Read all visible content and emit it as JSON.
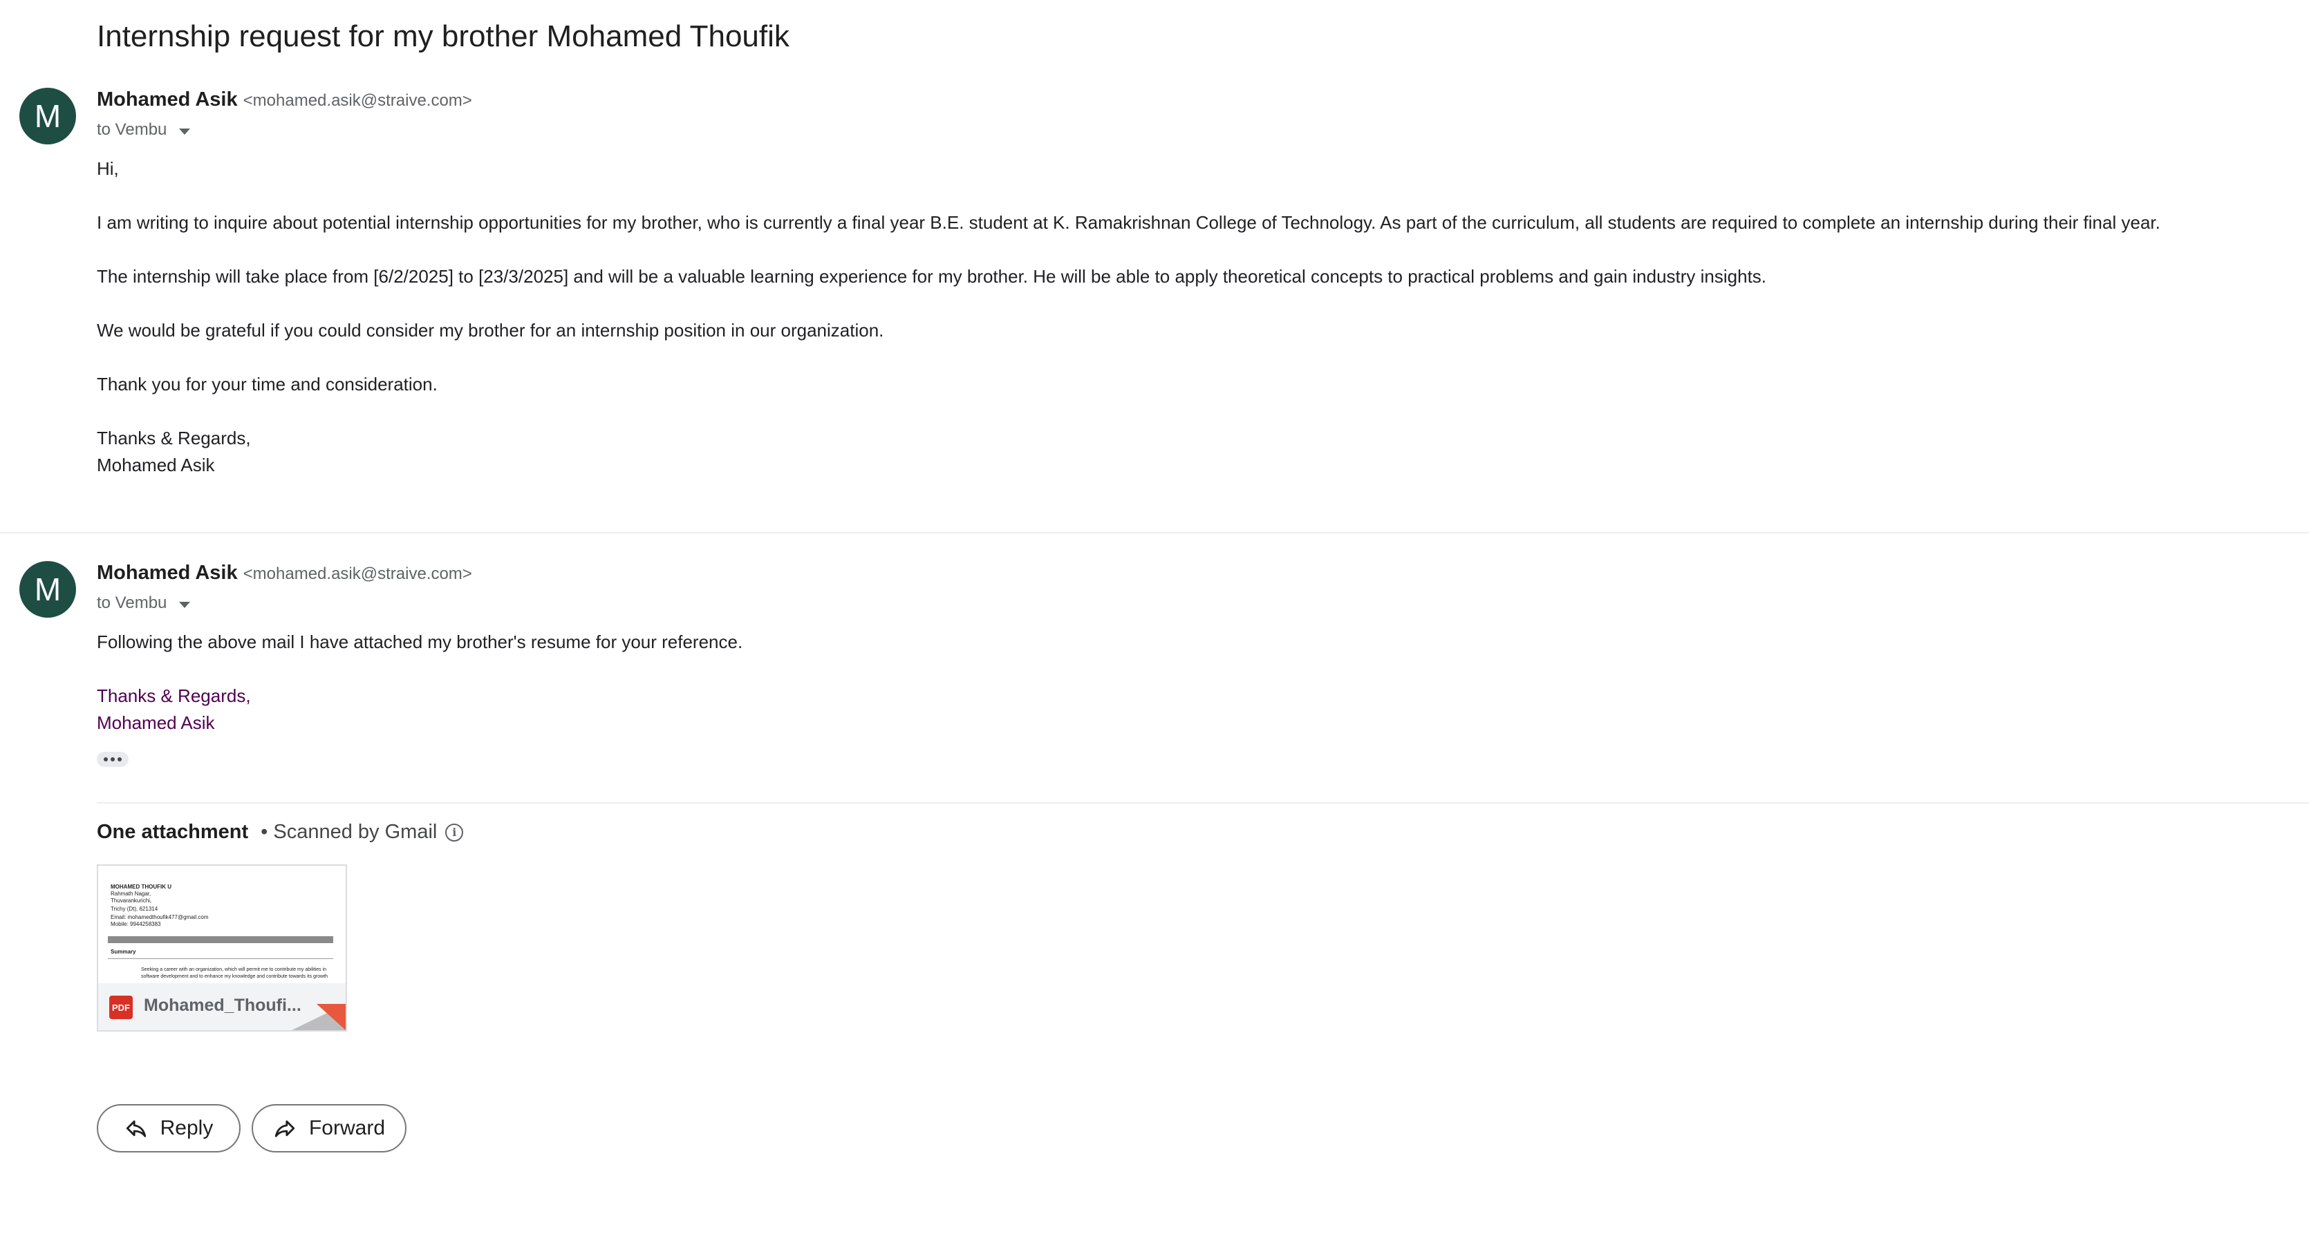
{
  "subject": "Internship request for my brother Mohamed Thoufik",
  "messages": [
    {
      "avatar_letter": "M",
      "sender_name": "Mohamed Asik",
      "sender_email": "<mohamed.asik@straive.com>",
      "to": "to Vembu",
      "body": {
        "greeting": "Hi,",
        "p1": "I am writing to inquire about potential internship opportunities for my brother, who is currently a final year B.E. student at K. Ramakrishnan College of Technology. As part of the curriculum, all students are required to complete an internship during their final year.",
        "p2": "The internship will take place from [6/2/2025] to [23/3/2025] and will be a valuable learning experience for my brother. He will be able to apply theoretical concepts to practical problems and gain industry insights.",
        "p3": "We would be grateful if you could consider my brother for an internship position in our organization.",
        "p4": "Thank you for your time and consideration.",
        "sig1": "Thanks & Regards,",
        "sig2": "Mohamed Asik"
      }
    },
    {
      "avatar_letter": "M",
      "sender_name": "Mohamed Asik",
      "sender_email": "<mohamed.asik@straive.com>",
      "to": "to Vembu",
      "body": {
        "p1": "Following the above mail I have attached my brother's resume for your reference.",
        "sig1": "Thanks & Regards,",
        "sig2": "Mohamed Asik"
      }
    }
  ],
  "attachments": {
    "heading": "One attachment",
    "scanned": "• Scanned by Gmail",
    "file_name": "Mohamed_Thoufi...",
    "file_type": "PDF",
    "preview": {
      "name": "MOHAMED THOUFIK U",
      "l1": "Rahmath Nagar,",
      "l2": "Thuvarankurichi,",
      "l3": "Trichy (Dt), 621314",
      "l4": "Email: mohamedthoufik477@gmail.com",
      "l5": "Mobile: 9944258383",
      "section": "Summary",
      "s1": "Seeking a career with an organization, which will permit me to contribute my abilities in",
      "s2": "software development and to enhance my knowledge and contribute towards its growth"
    }
  },
  "actions": {
    "reply": "Reply",
    "forward": "Forward"
  },
  "colors": {
    "avatar_bg": "#1e4d44",
    "signature": "#500050",
    "pdf_red": "#d93025"
  }
}
